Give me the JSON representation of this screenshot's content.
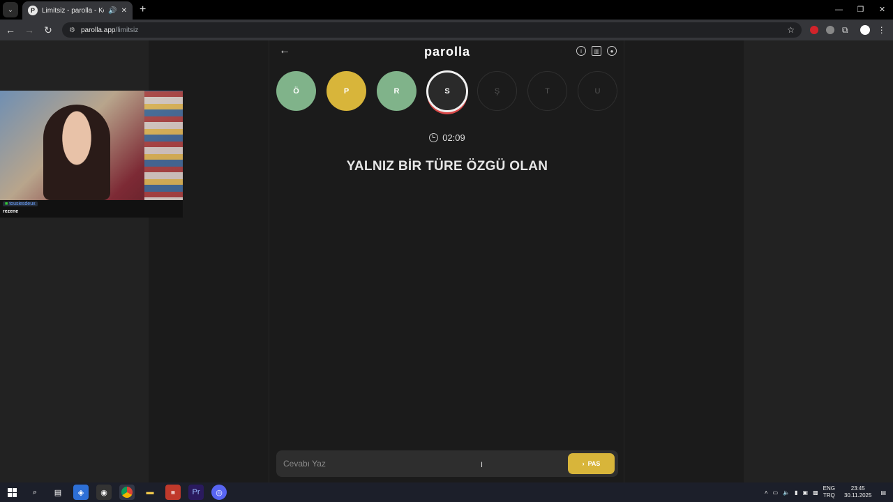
{
  "browser": {
    "tab_title": "Limitsiz - parolla - Kelime o",
    "favicon_letter": "P",
    "url_host": "parolla.app",
    "url_path": "/limitsiz"
  },
  "webcam": {
    "username": "tousiesdeux",
    "message": "rezene"
  },
  "app": {
    "logo": "parolla",
    "letters": [
      {
        "char": "Ö",
        "state": "correct"
      },
      {
        "char": "P",
        "state": "passed"
      },
      {
        "char": "R",
        "state": "correct"
      },
      {
        "char": "S",
        "state": "current"
      },
      {
        "char": "Ş",
        "state": "empty"
      },
      {
        "char": "T",
        "state": "empty"
      },
      {
        "char": "U",
        "state": "empty"
      }
    ],
    "timer": "02:09",
    "question": "YALNIZ BİR TÜRE ÖZGÜ OLAN",
    "answer_placeholder": "Cevabı Yaz",
    "pas_label": "PAS",
    "colors": {
      "correct": "#80b38a",
      "passed": "#d8b53a",
      "current_ring": "#d94a4a"
    }
  },
  "taskbar": {
    "lang_top": "ENG",
    "lang_bottom": "TRQ",
    "time": "23:45",
    "date": "30.11.2025"
  }
}
